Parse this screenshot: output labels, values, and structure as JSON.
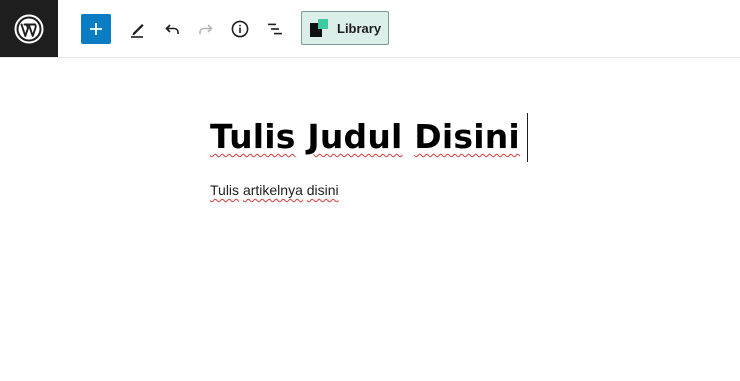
{
  "toolbar": {
    "library_label": "Library"
  },
  "editor": {
    "title_words": [
      "Tulis",
      "Judul",
      "Disini"
    ],
    "paragraph_words": [
      "Tulis",
      "artikelnya",
      "disini"
    ]
  },
  "colors": {
    "logo_bg": "#1e1e1e",
    "add_button_bg": "#0a7cc4",
    "library_bg": "#dbeeea",
    "library_accent": "#3fc9a3",
    "spellcheck_underline": "#d23b3b"
  },
  "icons": [
    "wordpress-icon",
    "plus-icon",
    "pencil-icon",
    "undo-icon",
    "redo-icon",
    "info-icon",
    "list-view-icon",
    "library-icon"
  ]
}
